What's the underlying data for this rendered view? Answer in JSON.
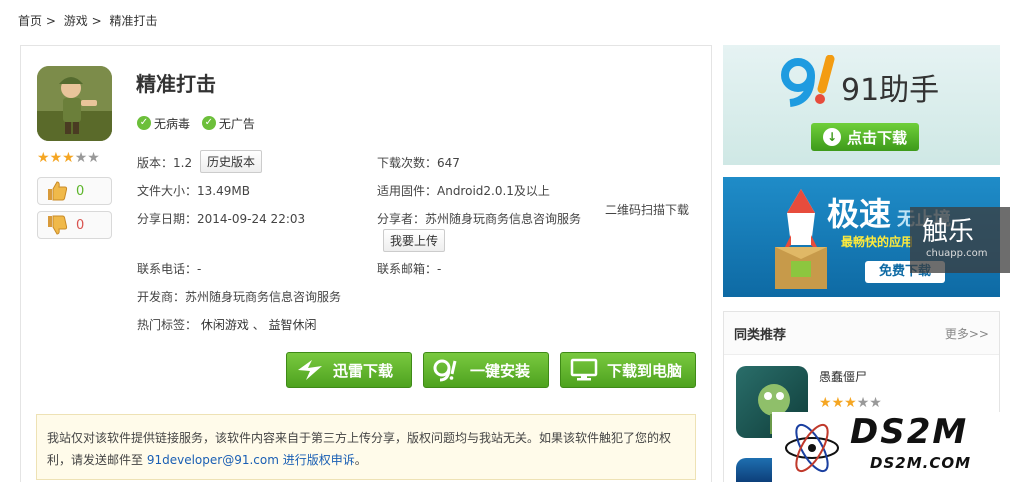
{
  "breadcrumb": {
    "home": "首页",
    "sep1": ">",
    "games": "游戏",
    "sep2": ">",
    "current": "精准打击"
  },
  "app": {
    "title": "精准打击",
    "badges": [
      "无病毒",
      "无广告"
    ],
    "rating_filled": 3,
    "rating_total": 5,
    "likes": "0",
    "dislikes": "0",
    "version": "版本：1.2",
    "history_btn": "历史版本",
    "size": "文件大小：13.49MB",
    "share_date": "分享日期：2014-09-24 22:03",
    "downloads": "下载次数：647",
    "firmware": "适用固件：Android2.0.1及以上",
    "sharer": "分享者：苏州随身玩商务信息咨询服务",
    "upload_btn": "我要上传",
    "qr_text": "二维码扫描下载",
    "phone": "联系电话：-",
    "email": "联系邮箱：-",
    "developer": "开发商：苏州随身玩商务信息咨询服务",
    "tags_label": "热门标签：",
    "tag1": "休闲游戏",
    "tag_sep": "、",
    "tag2": "益智休闲"
  },
  "downloads": {
    "xunlei": "迅雷下载",
    "one_click": "一键安装",
    "to_pc": "下载到电脑"
  },
  "notice": {
    "line1": "我站仅对该软件提供链接服务，该软件内容来自于第三方上传分享，版权问题均与我站无关。如果该软件触犯了您的权",
    "line2_pre": "利，请发送邮件至",
    "link": "91developer@91.com 进行版权申诉",
    "line2_post": "。"
  },
  "ads": {
    "ad1_brand": "91助手",
    "ad1_btn": "点击下载",
    "ad2_title": "极速",
    "ad2_title_rest": "无止境",
    "ad2_sub": "最畅快的应用",
    "ad2_btn": "免费下载"
  },
  "watermark": {
    "chuapp": "触乐",
    "chuapp_url": "chuapp.com",
    "ds2m": "DS2M",
    "ds2m_url": "DS2M.COM"
  },
  "sidebar": {
    "title": "同类推荐",
    "more": "更多>>",
    "item1": "愚蠢僵尸",
    "item1_rating_filled": 3
  },
  "colors": {
    "green": "#5cb52a",
    "link": "#1a5fb4",
    "star": "#f5a623"
  }
}
